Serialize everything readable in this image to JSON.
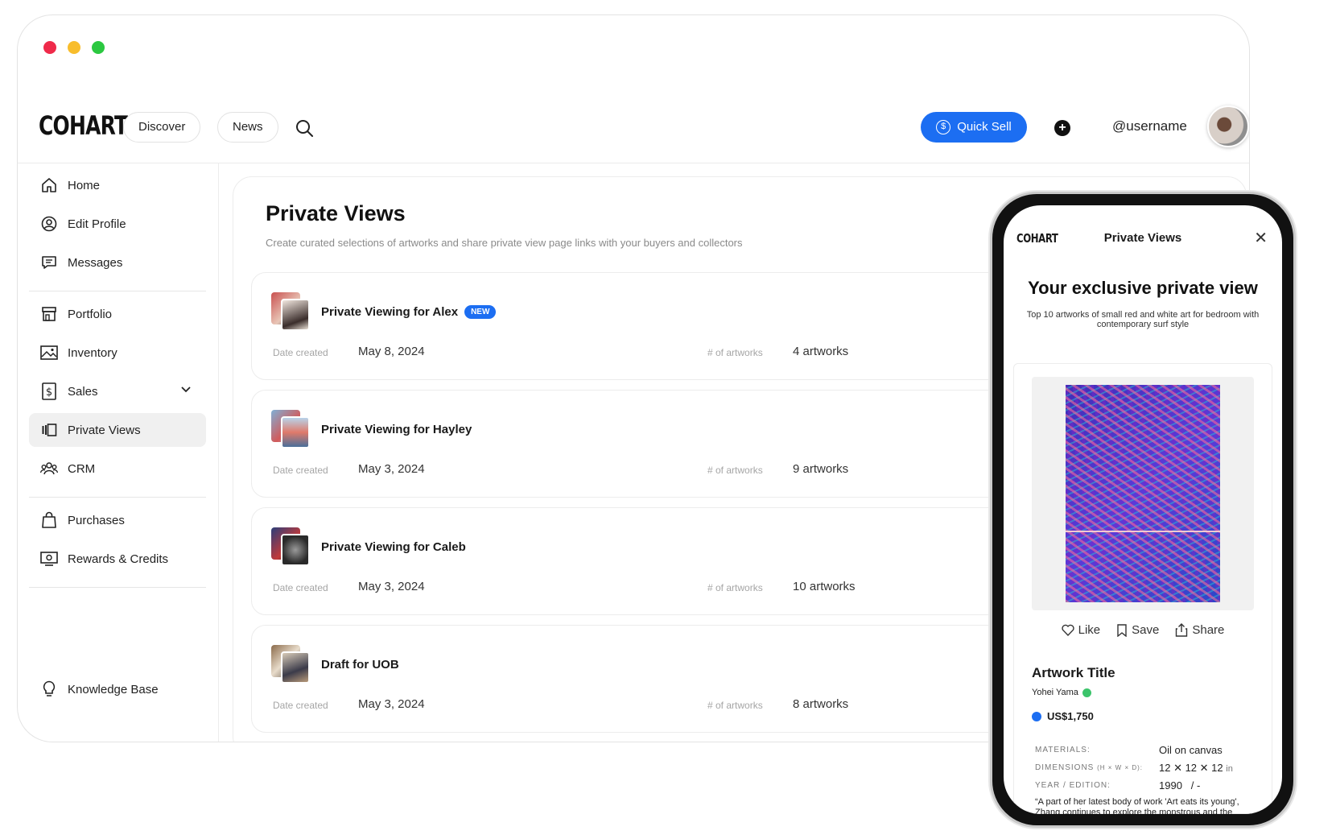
{
  "brand": "COHART",
  "header": {
    "discover": "Discover",
    "news": "News",
    "quick_sell": "Quick Sell",
    "username": "@username"
  },
  "sidebar": {
    "items": [
      {
        "label": "Home",
        "icon": "home-icon"
      },
      {
        "label": "Edit Profile",
        "icon": "user-circle-icon"
      },
      {
        "label": "Messages",
        "icon": "message-icon"
      },
      {
        "label": "Portfolio",
        "icon": "storefront-icon"
      },
      {
        "label": "Inventory",
        "icon": "image-icon"
      },
      {
        "label": "Sales",
        "icon": "dollar-icon"
      },
      {
        "label": "Private Views",
        "icon": "private-views-icon"
      },
      {
        "label": "CRM",
        "icon": "people-icon"
      },
      {
        "label": "Purchases",
        "icon": "bag-icon"
      },
      {
        "label": "Rewards & Credits",
        "icon": "rewards-icon"
      },
      {
        "label": "Knowledge Base",
        "icon": "lightbulb-icon"
      }
    ]
  },
  "main": {
    "title": "Private Views",
    "subtitle": "Create curated selections of artworks and share private view page links with your buyers and collectors",
    "date_label": "Date created",
    "count_label": "# of artworks",
    "cards": [
      {
        "title": "Private Viewing for Alex",
        "badge": "NEW",
        "date": "May 8, 2024",
        "count": "4 artworks"
      },
      {
        "title": "Private Viewing for Hayley",
        "date": "May 3, 2024",
        "count": "9 artworks"
      },
      {
        "title": "Private Viewing for Caleb",
        "date": "May 3, 2024",
        "count": "10 artworks"
      },
      {
        "title": "Draft for UOB",
        "date": "May 3, 2024",
        "count": "8 artworks"
      }
    ]
  },
  "phone": {
    "logo": "COHART",
    "title": "Private Views",
    "close": "✕",
    "headline": "Your exclusive private view",
    "description": "Top 10 artworks of small red and white art for bedroom with contemporary surf style",
    "like": "Like",
    "save": "Save",
    "share": "Share",
    "artwork_title": "Artwork Title",
    "artist": "Yohei Yama",
    "price": "US$1,750",
    "materials_label": "MATERIALS:",
    "materials": "Oil on canvas",
    "dimensions_label": "DIMENSIONS",
    "dimensions_hint": "(H × W × D):",
    "dimensions": "12 ✕ 12 ✕ 12",
    "dimensions_unit": "in",
    "year_label": "YEAR / EDITION:",
    "year": "1990",
    "edition": "/   -",
    "quote": "“A part of her latest body of work 'Art eats its young', Zhang continues to explore the monstrous and the grotesque, drawing on elements"
  },
  "colors": {
    "accent": "#1c6ef2",
    "verified": "#3cc46b"
  }
}
